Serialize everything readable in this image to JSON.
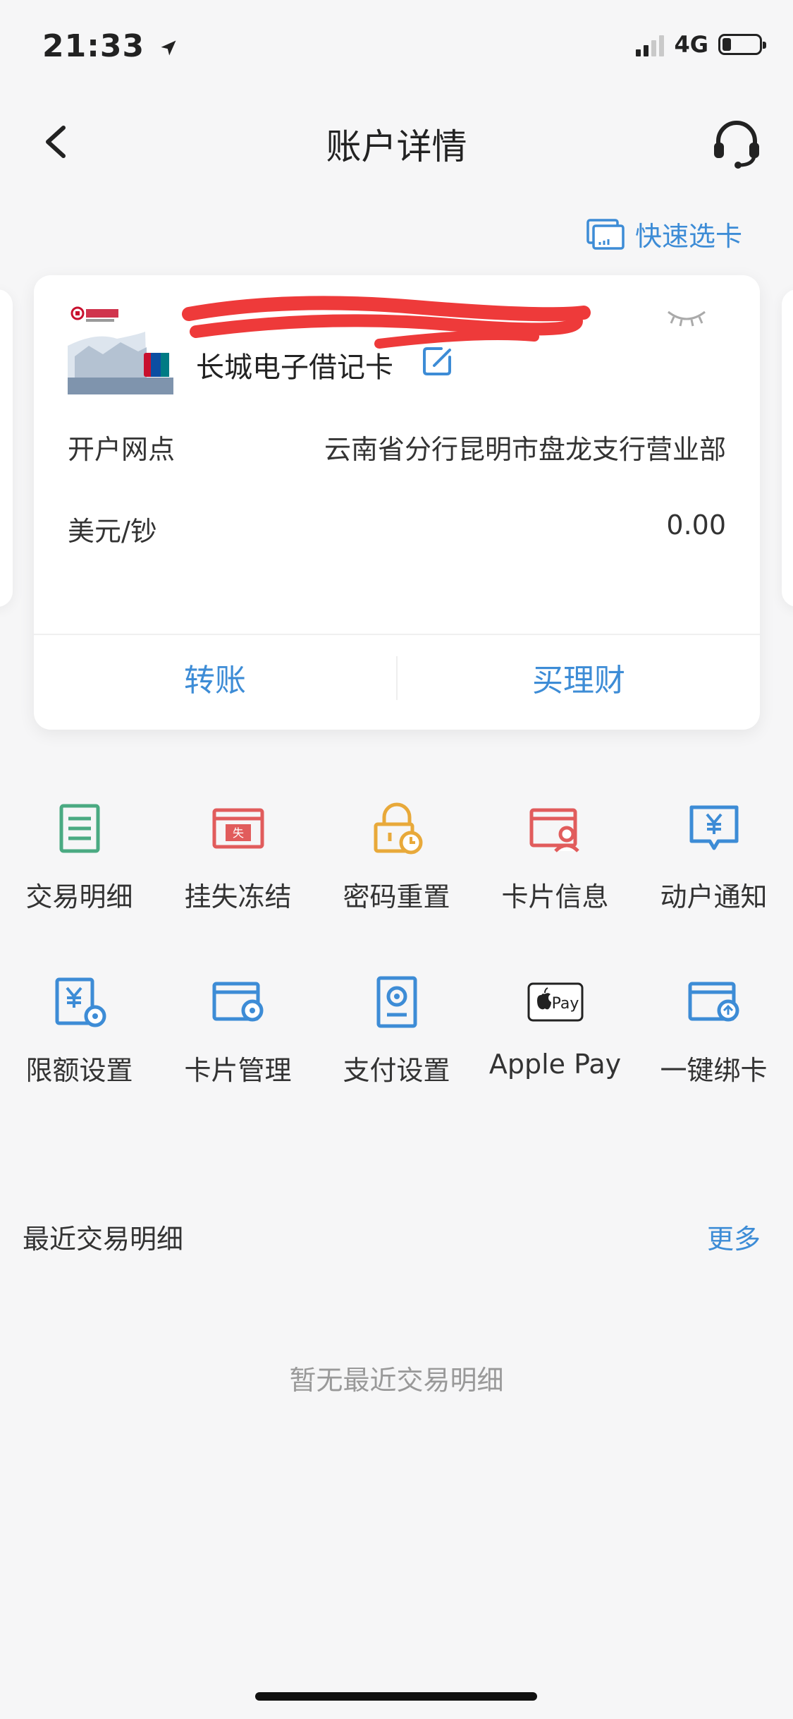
{
  "status_bar": {
    "time": "21:33",
    "network": "4G"
  },
  "nav": {
    "title": "账户详情"
  },
  "quick_select": {
    "label": "快速选卡"
  },
  "card": {
    "name": "长城电子借记卡",
    "rows": [
      {
        "label": "开户网点",
        "value": "云南省分行昆明市盘龙支行营业部"
      },
      {
        "label": "美元/钞",
        "value": "0.00"
      }
    ],
    "actions": [
      "转账",
      "买理财"
    ]
  },
  "functions": [
    {
      "label": "交易明细",
      "icon": "document-list-icon",
      "color": "#4aaa82"
    },
    {
      "label": "挂失冻结",
      "icon": "card-lost-icon",
      "color": "#e15c5c"
    },
    {
      "label": "密码重置",
      "icon": "lock-reset-icon",
      "color": "#e8a93a"
    },
    {
      "label": "卡片信息",
      "icon": "card-person-icon",
      "color": "#e15c5c"
    },
    {
      "label": "动户通知",
      "icon": "yuan-message-icon",
      "color": "#3d8cd6"
    },
    {
      "label": "限额设置",
      "icon": "yuan-gear-icon",
      "color": "#3d8cd6"
    },
    {
      "label": "卡片管理",
      "icon": "card-gear-icon",
      "color": "#3d8cd6"
    },
    {
      "label": "支付设置",
      "icon": "pay-settings-icon",
      "color": "#3d8cd6"
    },
    {
      "label": "Apple Pay",
      "icon": "apple-pay-icon",
      "color": "#222222",
      "icon_text": "Pay"
    },
    {
      "label": "一键绑卡",
      "icon": "card-bind-icon",
      "color": "#3d8cd6"
    }
  ],
  "recent": {
    "title": "最近交易明细",
    "more": "更多",
    "empty": "暂无最近交易明细"
  },
  "colors": {
    "accent": "#3d8cd6",
    "background": "#f6f6f7",
    "card": "#ffffff"
  }
}
